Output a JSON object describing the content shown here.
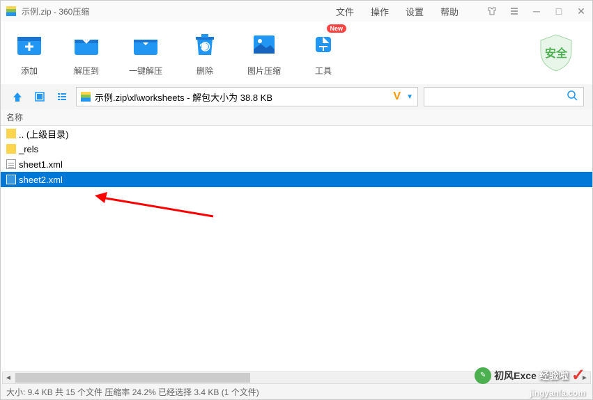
{
  "titlebar": {
    "title": "示例.zip - 360压缩"
  },
  "menu": {
    "file": "文件",
    "operate": "操作",
    "settings": "设置",
    "help": "帮助"
  },
  "toolbar": {
    "add": "添加",
    "extract_to": "解压到",
    "one_click": "一键解压",
    "delete": "删除",
    "image_compress": "图片压缩",
    "tools": "工具",
    "new_badge": "New",
    "safe": "安全"
  },
  "pathbar": {
    "path": "示例.zip\\xl\\worksheets - 解包大小为 38.8 KB"
  },
  "columns": {
    "name": "名称"
  },
  "files": [
    {
      "name": ".. (上级目录)",
      "type": "folder"
    },
    {
      "name": "_rels",
      "type": "folder"
    },
    {
      "name": "sheet1.xml",
      "type": "xml"
    },
    {
      "name": "sheet2.xml",
      "type": "xml",
      "selected": true
    }
  ],
  "statusbar": {
    "text": "大小: 9.4 KB 共 15 个文件 压缩率 24.2% 已经选择 3.4 KB (1 个文件)"
  },
  "watermark": {
    "text1": "初风Exce",
    "text2": "经验啦",
    "url": "jingyanla.com"
  }
}
